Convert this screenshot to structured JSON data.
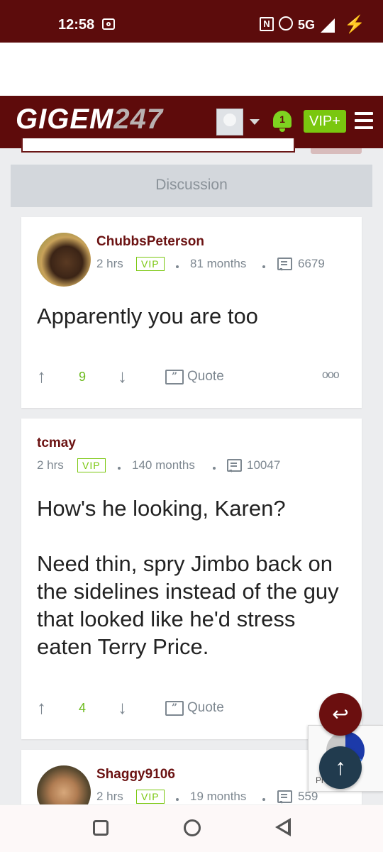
{
  "status_bar": {
    "time": "12:58",
    "network": "5G",
    "icons": [
      "camera-icon",
      "nfc-icon",
      "alarm-icon",
      "signal-icon",
      "charging-icon"
    ]
  },
  "header": {
    "logo_text": "GIGEM",
    "logo_number": "247",
    "notification_count": "1",
    "vip_label": "VIP+",
    "icons": [
      "user-avatar-icon",
      "chevron-down-icon",
      "bell-icon",
      "menu-icon"
    ]
  },
  "discussion": {
    "label": "Discussion"
  },
  "posts": [
    {
      "username": "ChubbsPeterson",
      "time": "2 hrs",
      "badge": "VIP",
      "tenure": "81 months",
      "post_count": "6679",
      "body": "Apparently you are too",
      "votes": "9",
      "quote_label": "Quote"
    },
    {
      "username": "tcmay",
      "time": "2 hrs",
      "badge": "VIP",
      "tenure": "140 months",
      "post_count": "10047",
      "body": "How's he looking, Karen?\n\nNeed thin, spry Jimbo back on the sidelines instead of the guy that looked like he'd stress eaten Terry Price.",
      "votes": "4",
      "quote_label": "Quote"
    },
    {
      "username": "Shaggy9106",
      "time": "2 hrs",
      "badge": "VIP",
      "tenure": "19 months",
      "post_count": "559"
    }
  ],
  "recaptcha": {
    "text": "Pr       erms"
  },
  "colors": {
    "brand": "#5e0b0b",
    "accent_green": "#7ac70f",
    "username": "#6b1212"
  }
}
